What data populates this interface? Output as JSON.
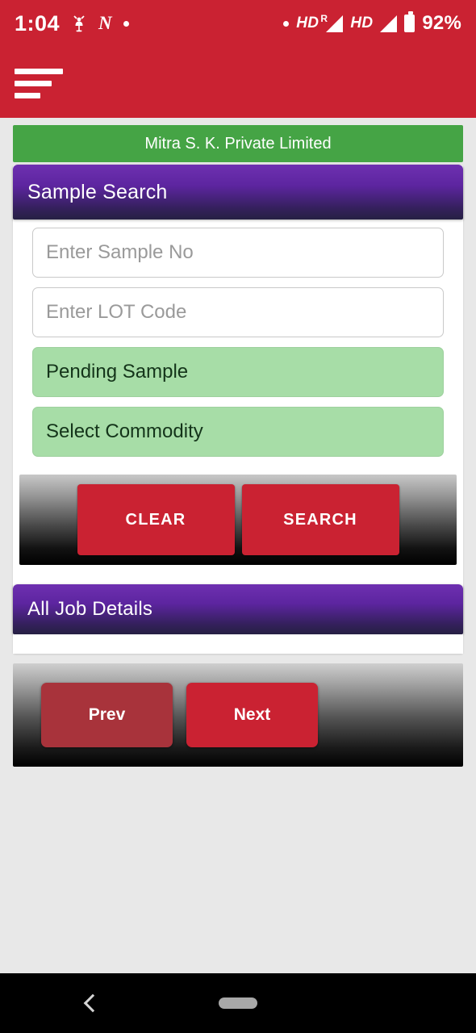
{
  "status_bar": {
    "time": "1:04",
    "icons_left": [
      "scooter-icon",
      "nfc-n-icon",
      "dot-icon"
    ],
    "dot": "•",
    "nfc_letter": "N",
    "hd_label_1": "HD",
    "roaming_label": "R",
    "hd_label_2": "HD",
    "battery_percent": "92%",
    "background_color": "#ca2232"
  },
  "app_bar": {
    "menu_icon": "hamburger-menu-icon",
    "background_color": "#ca2232"
  },
  "company": {
    "name": "Mitra S. K. Private Limited",
    "background_color": "#45a445"
  },
  "sample_search": {
    "title": "Sample Search",
    "header_color": "#5d25a0",
    "sample_no": {
      "value": "",
      "placeholder": "Enter Sample No"
    },
    "lot_code": {
      "value": "",
      "placeholder": "Enter LOT Code"
    },
    "status_select": {
      "value": "Pending Sample",
      "background_color": "#a7dda7"
    },
    "commodity_select": {
      "value": "Select Commodity",
      "background_color": "#a7dda7"
    },
    "clear_label": "CLEAR",
    "search_label": "SEARCH",
    "button_color": "#ca2232"
  },
  "job_details": {
    "title": "All Job Details",
    "header_color": "#5d25a0",
    "rows": []
  },
  "pagination": {
    "prev_label": "Prev",
    "next_label": "Next",
    "prev_color": "#a8333b",
    "next_color": "#ca2232"
  },
  "nav_bar": {
    "back_icon": "back-chevron-icon",
    "home_icon": "home-pill-icon",
    "background_color": "#000000"
  }
}
